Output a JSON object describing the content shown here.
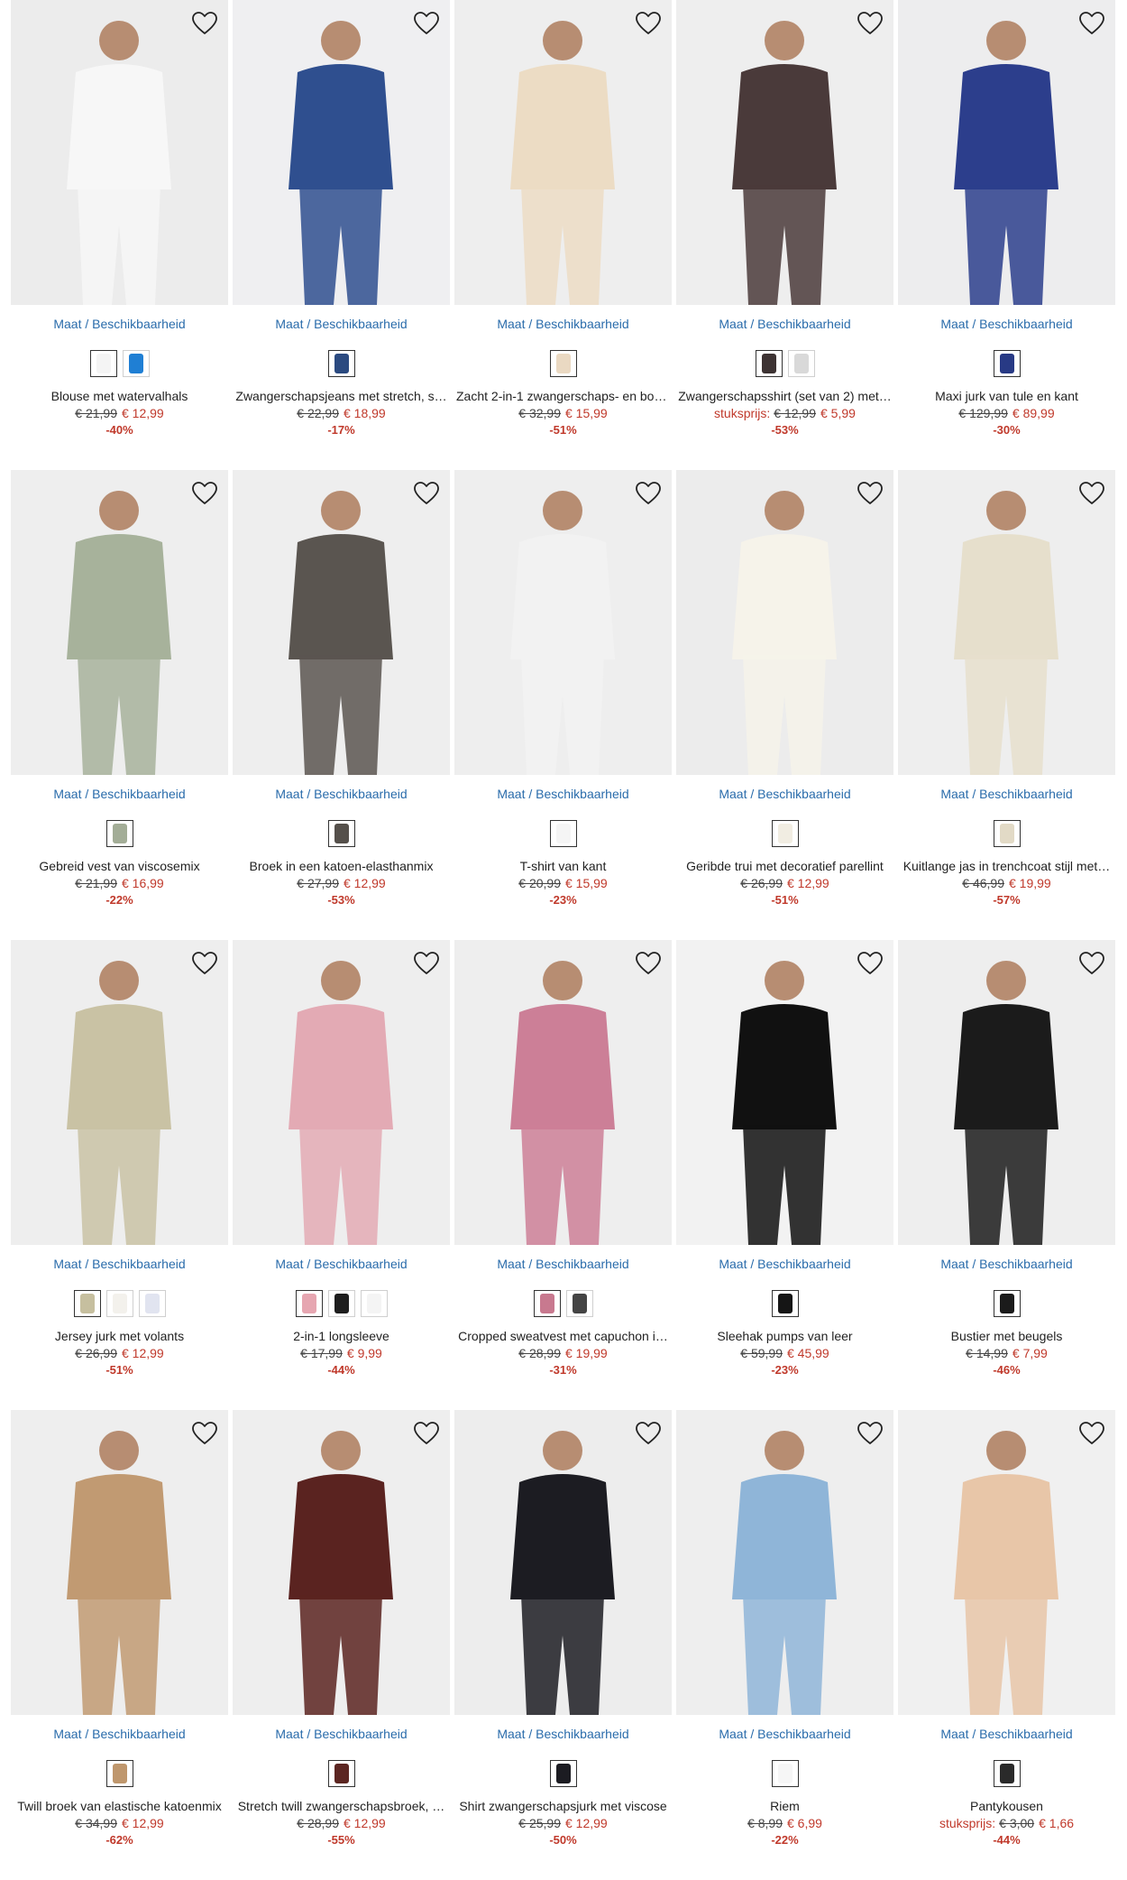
{
  "size_link_label": "Maat / Beschikbaarheid",
  "wishlist_icon": "heart-outline-icon",
  "colors": {
    "link": "#2a6cab",
    "sale": "#c0392b"
  },
  "products": [
    {
      "name": "Blouse met watervalhals",
      "unit_prefix": "",
      "old_price": "€ 21,99",
      "new_price": "€ 12,99",
      "discount": "-40%",
      "bg": "#ececec",
      "figure": "#f7f7f7",
      "swatches": [
        "#f4f4f4",
        "#1f7fd4"
      ]
    },
    {
      "name": "Zwangerschapsjeans met stretch, s…",
      "unit_prefix": "",
      "old_price": "€ 22,99",
      "new_price": "€ 18,99",
      "discount": "-17%",
      "bg": "#efeff1",
      "figure": "#2f4f8f",
      "swatches": [
        "#2b4a80"
      ]
    },
    {
      "name": "Zacht 2-in-1 zwangerschaps- en bor…",
      "unit_prefix": "",
      "old_price": "€ 32,99",
      "new_price": "€ 15,99",
      "discount": "-51%",
      "bg": "#eeeeee",
      "figure": "#ecdcc4",
      "swatches": [
        "#ead9c2"
      ]
    },
    {
      "name": "Zwangerschapsshirt (set van 2) met…",
      "unit_prefix": "stuksprijs:",
      "old_price": "€ 12,99",
      "new_price": "€ 5,99",
      "discount": "-53%",
      "bg": "#eeeeee",
      "figure": "#4a3a3a",
      "swatches": [
        "#3d3333",
        "#d9d9d9"
      ]
    },
    {
      "name": "Maxi jurk van tule en kant",
      "unit_prefix": "",
      "old_price": "€ 129,99",
      "new_price": "€ 89,99",
      "discount": "-30%",
      "bg": "#ededee",
      "figure": "#2c3e8c",
      "swatches": [
        "#283a85"
      ]
    },
    {
      "name": "Gebreid vest van viscosemix",
      "unit_prefix": "",
      "old_price": "€ 21,99",
      "new_price": "€ 16,99",
      "discount": "-22%",
      "bg": "#eeeeee",
      "figure": "#a7b29b",
      "swatches": [
        "#a3ad97"
      ]
    },
    {
      "name": "Broek in een katoen-elasthanmix",
      "unit_prefix": "",
      "old_price": "€ 27,99",
      "new_price": "€ 12,99",
      "discount": "-53%",
      "bg": "#eeeeee",
      "figure": "#5a5550",
      "swatches": [
        "#55504b"
      ]
    },
    {
      "name": "T-shirt van kant",
      "unit_prefix": "",
      "old_price": "€ 20,99",
      "new_price": "€ 15,99",
      "discount": "-23%",
      "bg": "#eeeeee",
      "figure": "#f2f2f2",
      "swatches": [
        "#f5f5f5"
      ]
    },
    {
      "name": "Geribde trui met decoratief parellint",
      "unit_prefix": "",
      "old_price": "€ 26,99",
      "new_price": "€ 12,99",
      "discount": "-51%",
      "bg": "#ececec",
      "figure": "#f6f3ea",
      "swatches": [
        "#f1ede2"
      ]
    },
    {
      "name": "Kuitlange jas in trenchcoat stijl met…",
      "unit_prefix": "",
      "old_price": "€ 46,99",
      "new_price": "€ 19,99",
      "discount": "-57%",
      "bg": "#eeeeee",
      "figure": "#e6dfcc",
      "swatches": [
        "#e2dac6"
      ]
    },
    {
      "name": "Jersey jurk met volants",
      "unit_prefix": "",
      "old_price": "€ 26,99",
      "new_price": "€ 12,99",
      "discount": "-51%",
      "bg": "#eeeeee",
      "figure": "#c9c2a4",
      "swatches": [
        "#c6bf9f",
        "#f3f1ec",
        "#e1e4f0"
      ]
    },
    {
      "name": "2-in-1 longsleeve",
      "unit_prefix": "",
      "old_price": "€ 17,99",
      "new_price": "€ 9,99",
      "discount": "-44%",
      "bg": "#eeeeee",
      "figure": "#e3aab4",
      "swatches": [
        "#e6a6b1",
        "#1e1e1e",
        "#f4f4f4"
      ]
    },
    {
      "name": "Cropped sweatvest met capuchon i…",
      "unit_prefix": "",
      "old_price": "€ 28,99",
      "new_price": "€ 19,99",
      "discount": "-31%",
      "bg": "#eeeeee",
      "figure": "#cc7f97",
      "swatches": [
        "#c8798f",
        "#444444"
      ]
    },
    {
      "name": "Sleehak pumps van leer",
      "unit_prefix": "",
      "old_price": "€ 59,99",
      "new_price": "€ 45,99",
      "discount": "-23%",
      "bg": "#f2f2f2",
      "figure": "#111111",
      "swatches": [
        "#151515"
      ]
    },
    {
      "name": "Bustier met beugels",
      "unit_prefix": "",
      "old_price": "€ 14,99",
      "new_price": "€ 7,99",
      "discount": "-46%",
      "bg": "#eeeeee",
      "figure": "#1b1b1b",
      "swatches": [
        "#1b1b1b"
      ]
    },
    {
      "name": "Twill broek van elastische katoenmix",
      "unit_prefix": "",
      "old_price": "€ 34,99",
      "new_price": "€ 12,99",
      "discount": "-62%",
      "bg": "#eeeeee",
      "figure": "#c19a72",
      "swatches": [
        "#bf976d"
      ]
    },
    {
      "name": "Stretch twill zwangerschapsbroek, …",
      "unit_prefix": "",
      "old_price": "€ 28,99",
      "new_price": "€ 12,99",
      "discount": "-55%",
      "bg": "#eeeeee",
      "figure": "#5a2320",
      "swatches": [
        "#5c2622"
      ]
    },
    {
      "name": "Shirt zwangerschapsjurk met viscose",
      "unit_prefix": "",
      "old_price": "€ 25,99",
      "new_price": "€ 12,99",
      "discount": "-50%",
      "bg": "#ededed",
      "figure": "#1c1c22",
      "swatches": [
        "#1c1c22"
      ]
    },
    {
      "name": "Riem",
      "unit_prefix": "",
      "old_price": "€ 8,99",
      "new_price": "€ 6,99",
      "discount": "-22%",
      "bg": "#eeeeee",
      "figure": "#8fb5d8",
      "swatches": [
        "#f6f6f6"
      ]
    },
    {
      "name": "Pantykousen",
      "unit_prefix": "stuksprijs:",
      "old_price": "€ 3,00",
      "new_price": "€ 1,66",
      "discount": "-44%",
      "bg": "#f0f0f0",
      "figure": "#e8c6a8",
      "swatches": [
        "#2a2a2a"
      ]
    }
  ]
}
